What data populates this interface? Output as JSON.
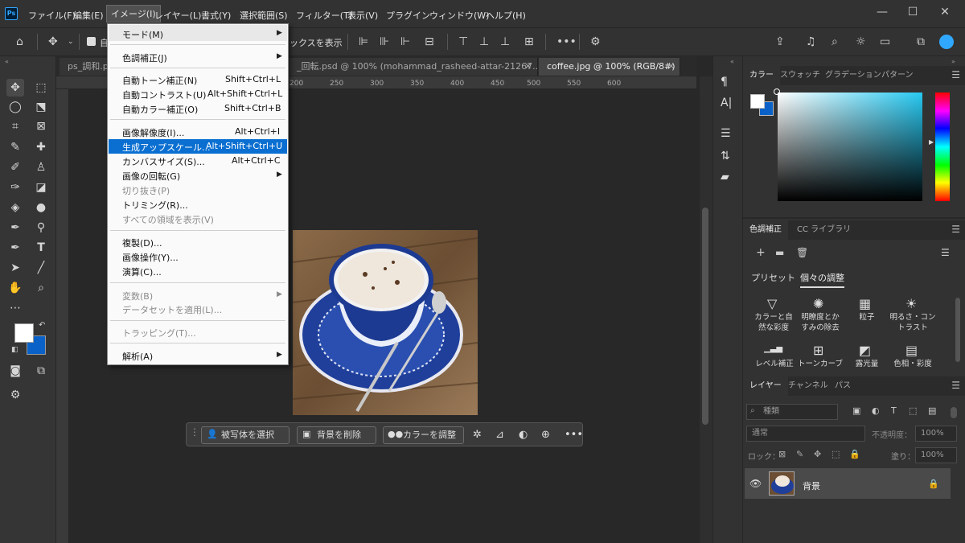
{
  "app": {
    "logo": "Ps"
  },
  "menubar": {
    "items": [
      "ファイル(F)",
      "編集(E)",
      "イメージ(I)",
      "レイヤー(L)",
      "書式(Y)",
      "選択範囲(S)",
      "フィルター(T)",
      "表示(V)",
      "プラグイン",
      "ウィンドウ(W)",
      "ヘルプ(H)"
    ],
    "window_controls": [
      "—",
      "☐",
      "✕"
    ]
  },
  "options_bar": {
    "checkbox_label": "自",
    "partial_text": "ックスを表示",
    "more": "•••"
  },
  "tabs": [
    {
      "label": "ps_調和.p"
    },
    {
      "label": "_回転.psd @ 100% (mohammad_rasheed-attar-21267..."
    },
    {
      "label": "coffee.jpg @ 100% (RGB/8#)"
    }
  ],
  "tab_close": "✕",
  "ruler_numbers": [
    "200",
    "250",
    "300",
    "350",
    "400",
    "450",
    "500",
    "550",
    "600"
  ],
  "image_menu": {
    "sections": [
      [
        {
          "label": "モード(M)",
          "submenu": true
        }
      ],
      [
        {
          "label": "色調補正(J)",
          "submenu": true
        }
      ],
      [
        {
          "label": "自動トーン補正(N)",
          "shortcut": "Shift+Ctrl+L"
        },
        {
          "label": "自動コントラスト(U)",
          "shortcut": "Alt+Shift+Ctrl+L"
        },
        {
          "label": "自動カラー補正(O)",
          "shortcut": "Shift+Ctrl+B"
        }
      ],
      [
        {
          "label": "画像解像度(I)...",
          "shortcut": "Alt+Ctrl+I"
        },
        {
          "label": "生成アップスケール...",
          "shortcut": "Alt+Shift+Ctrl+U",
          "highlighted": true
        },
        {
          "label": "カンバスサイズ(S)...",
          "shortcut": "Alt+Ctrl+C"
        },
        {
          "label": "画像の回転(G)",
          "submenu": true
        },
        {
          "label": "切り抜き(P)",
          "disabled": true
        },
        {
          "label": "トリミング(R)..."
        },
        {
          "label": "すべての領域を表示(V)",
          "disabled": true
        }
      ],
      [
        {
          "label": "複製(D)..."
        },
        {
          "label": "画像操作(Y)..."
        },
        {
          "label": "演算(C)..."
        }
      ],
      [
        {
          "label": "変数(B)",
          "disabled": true,
          "submenu": true
        },
        {
          "label": "データセットを適用(L)...",
          "disabled": true
        }
      ],
      [
        {
          "label": "トラッピング(T)...",
          "disabled": true
        }
      ],
      [
        {
          "label": "解析(A)",
          "submenu": true
        }
      ]
    ]
  },
  "context_bar": {
    "select_subject": "被写体を選択",
    "remove_background": "背景を削除",
    "adjust_color": "カラーを調整",
    "more": "•••"
  },
  "color_panel": {
    "tabs": [
      "カラー",
      "スウォッチ",
      "グラデーション",
      "パターン"
    ],
    "foreground": "#ffffff",
    "background": "#0a62c9"
  },
  "adjustments_panel": {
    "tabs": [
      "色調補正",
      "CC ライブラリ"
    ],
    "subtabs": [
      "プリセット",
      "個々の調整"
    ],
    "items": [
      {
        "icon": "▽",
        "label": "カラーと自然な彩度"
      },
      {
        "icon": "✺",
        "label": "明瞭度とかすみの除去"
      },
      {
        "icon": "▦",
        "label": "粒子"
      },
      {
        "icon": "☀",
        "label": "明るさ・コントラスト"
      },
      {
        "icon": "▁▃▅",
        "label": "レベル補正"
      },
      {
        "icon": "⊞",
        "label": "トーンカーブ"
      },
      {
        "icon": "◩",
        "label": "露光量"
      },
      {
        "icon": "▤",
        "label": "色相・彩度"
      }
    ]
  },
  "layers_panel": {
    "tabs": [
      "レイヤー",
      "チャンネル",
      "パス"
    ],
    "search_placeholder": "種類",
    "blend_mode": "通常",
    "opacity_label": "不透明度：",
    "opacity_value": "100%",
    "lock_label": "ロック：",
    "fill_label": "塗り：",
    "fill_value": "100%",
    "layers": [
      {
        "name": "背景"
      }
    ]
  }
}
